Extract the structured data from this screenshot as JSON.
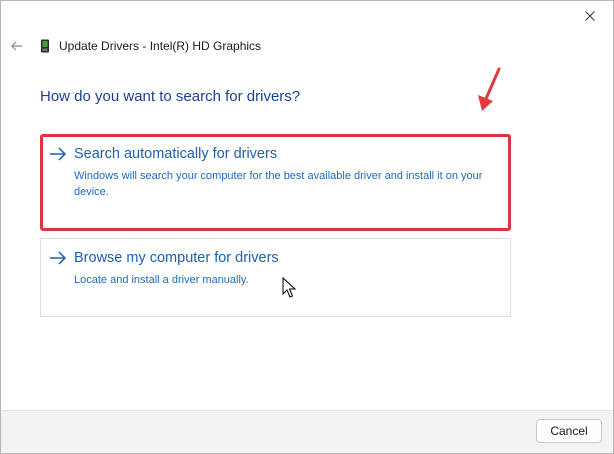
{
  "window": {
    "title": "Update Drivers - Intel(R) HD Graphics",
    "close_icon": "close-icon",
    "back_icon": "arrow-left-icon",
    "device_icon": "graphics-card-icon"
  },
  "main": {
    "question": "How do you want to search for drivers?",
    "options": [
      {
        "title": "Search automatically for drivers",
        "description": "Windows will search your computer for the best available driver and install it on your device.",
        "icon": "arrow-right-icon",
        "highlighted": true
      },
      {
        "title": "Browse my computer for drivers",
        "description": "Locate and install a driver manually.",
        "icon": "arrow-right-icon",
        "highlighted": false
      }
    ]
  },
  "footer": {
    "cancel_label": "Cancel"
  },
  "colors": {
    "accent": "#1e5fae",
    "question_text": "#1f3f8f",
    "highlight_border": "#d9363e"
  }
}
